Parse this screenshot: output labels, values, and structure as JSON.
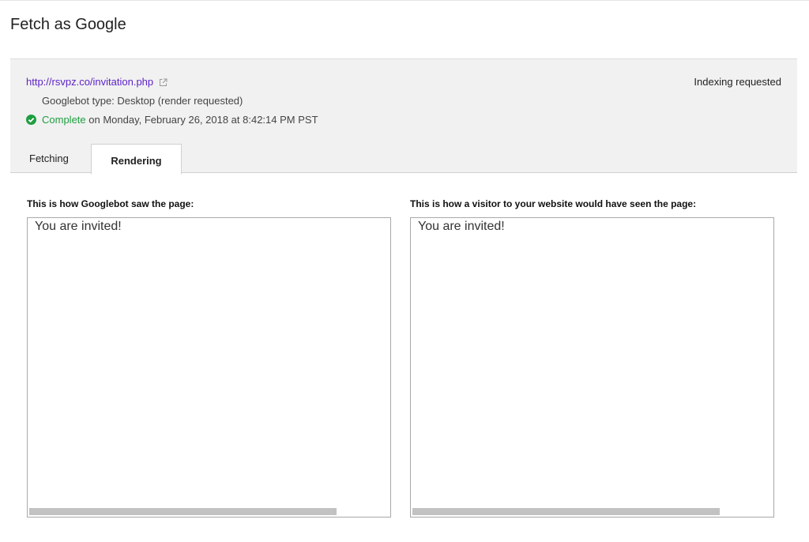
{
  "page": {
    "title": "Fetch as Google"
  },
  "summary": {
    "url": "http://rsvpz.co/invitation.php",
    "status": "Indexing requested",
    "bot_type": "Googlebot type: Desktop (render requested)",
    "complete_word": "Complete",
    "complete_rest": " on Monday, February 26, 2018 at 8:42:14 PM PST",
    "icons": {
      "external": "external-link-icon",
      "check": "check-circle-icon"
    },
    "colors": {
      "link": "#5d23c8",
      "complete": "#1e9e40"
    }
  },
  "tabs": [
    {
      "label": "Fetching",
      "selected": false
    },
    {
      "label": "Rendering",
      "selected": true
    }
  ],
  "panels": {
    "googlebot": {
      "heading": "This is how Googlebot saw the page:",
      "content": "You are invited!"
    },
    "visitor": {
      "heading": "This is how a visitor to your website would have seen the page:",
      "content": "You are invited!"
    }
  }
}
